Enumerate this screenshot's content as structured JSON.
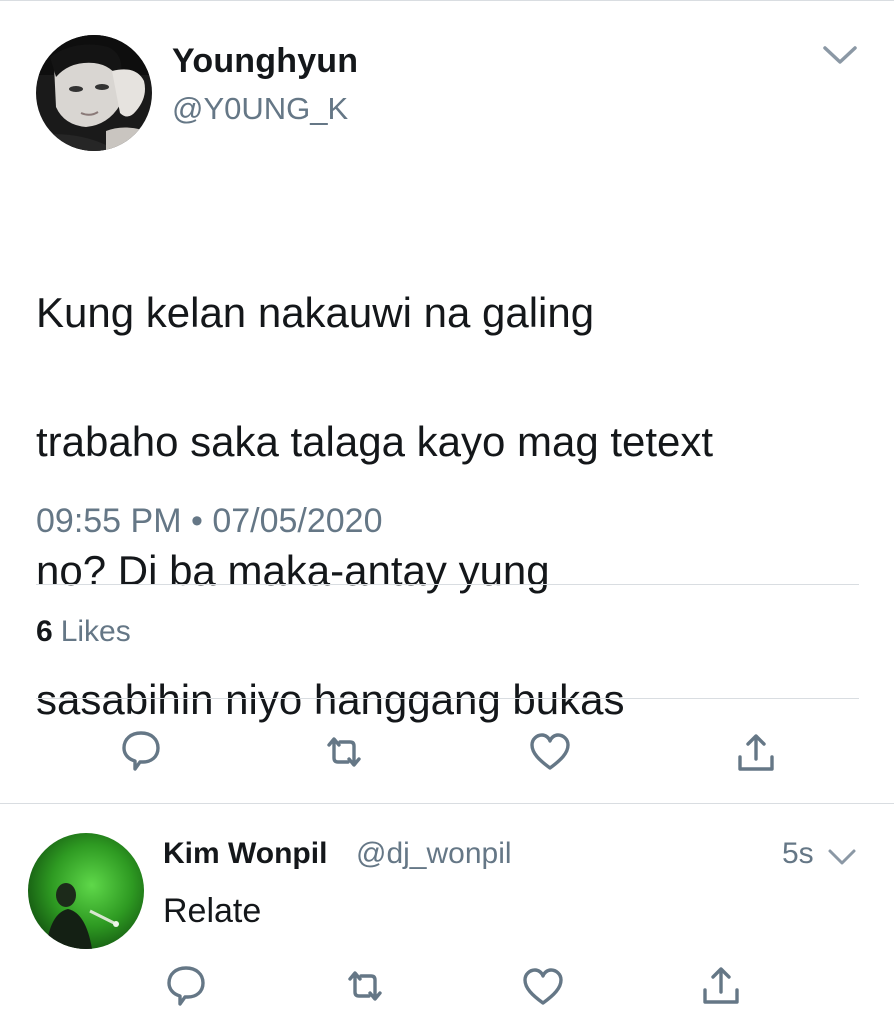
{
  "tweet": {
    "display_name": "Younghyun",
    "handle": "@Y0UNG_K",
    "text_lines": [
      "Kung kelan nakauwi na galing",
      "trabaho saka talaga kayo mag tetext",
      "no? Di ba maka-antay yung",
      "sasabihin niyo hanggang bukas"
    ],
    "timestamp": "09:55 PM • 07/05/2020",
    "likes_count": "6",
    "likes_label": "Likes"
  },
  "reply": {
    "display_name": "Kim Wonpil",
    "handle": "@dj_wonpil",
    "time": "5s",
    "text": "Relate"
  },
  "icons": {
    "more": "chevron-down-icon",
    "reply": "reply-icon",
    "retweet": "retweet-icon",
    "like": "heart-icon",
    "share": "share-icon"
  },
  "colors": {
    "primary_text": "#14171a",
    "secondary_text": "#657786",
    "icon_gray": "#657786",
    "divider": "#d9dde1"
  }
}
